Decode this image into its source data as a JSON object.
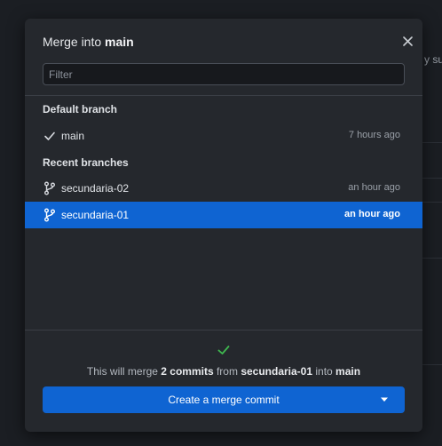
{
  "background": {
    "partial_text": "y su"
  },
  "dialog": {
    "title_prefix": "Merge into ",
    "title_branch": "main",
    "filter_placeholder": "Filter",
    "filter_value": ""
  },
  "default_branch": {
    "header": "Default branch",
    "items": [
      {
        "name": "main",
        "time": "7 hours ago",
        "icon": "check-icon"
      }
    ]
  },
  "recent_branches": {
    "header": "Recent branches",
    "items": [
      {
        "name": "secundaria-02",
        "time": "an hour ago",
        "icon": "git-branch-icon",
        "selected": false
      },
      {
        "name": "secundaria-01",
        "time": "an hour ago",
        "icon": "git-branch-icon",
        "selected": true
      }
    ]
  },
  "footer": {
    "status_icon": "check-icon",
    "msg_part1": "This will merge ",
    "msg_commits": "2 commits",
    "msg_part2": " from ",
    "msg_source": "secundaria-01",
    "msg_part3": " into ",
    "msg_target": "main",
    "button_label": "Create a merge commit",
    "button_dropdown_icon": "caret-down-icon"
  },
  "colors": {
    "accent": "#0f64d2",
    "success": "#3fb950",
    "dialog_bg": "#25282d",
    "page_bg": "#1b1e23"
  }
}
